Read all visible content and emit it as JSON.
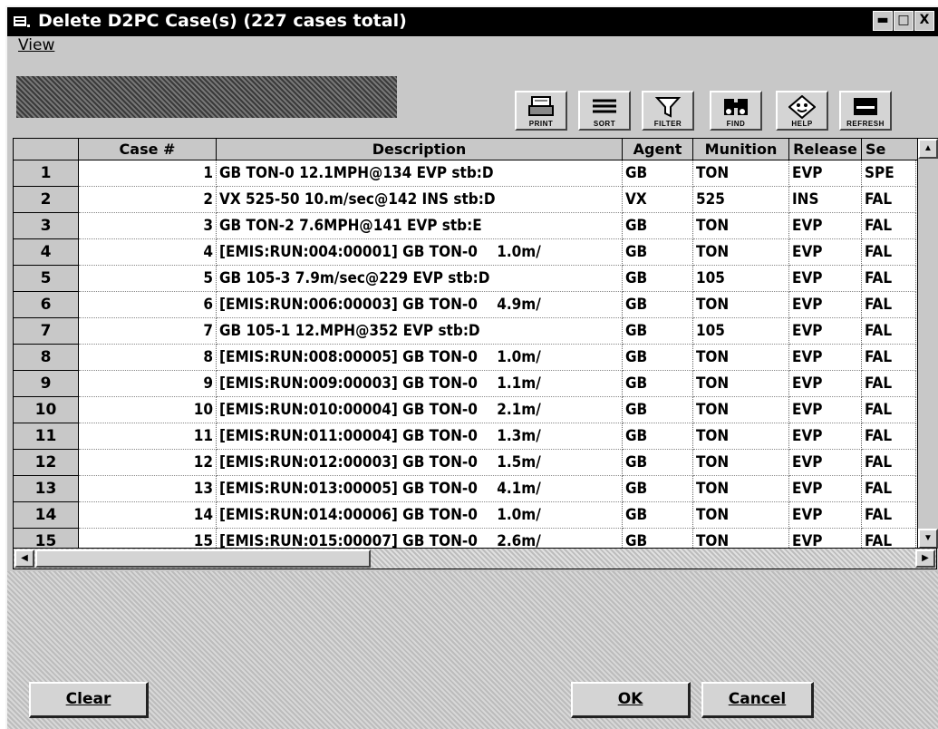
{
  "window": {
    "title": "Delete D2PC Case(s)  (227 cases total)",
    "controls": {
      "minimize": "▬",
      "maximize": "□",
      "close": "X"
    }
  },
  "menu": {
    "view": "View"
  },
  "toolbar": {
    "buttons": [
      {
        "icon": "printer-icon",
        "label": "PRINT"
      },
      {
        "icon": "sort-icon",
        "label": "SORT"
      },
      {
        "icon": "filter-icon",
        "label": "FILTER"
      },
      {
        "icon": "binoculars-icon",
        "label": "FIND"
      },
      {
        "icon": "help-icon",
        "label": "HELP"
      },
      {
        "icon": "refresh-icon",
        "label": "REFRESH"
      }
    ]
  },
  "table": {
    "columns": [
      "Case #",
      "Description",
      "Agent",
      "Munition",
      "Release",
      "Se"
    ],
    "rows": [
      {
        "n": "1",
        "case": "1",
        "desc": "GB TON-0 12.1MPH@134 EVP stb:D",
        "agent": "GB",
        "munition": "TON",
        "release": "EVP",
        "se": "SPE"
      },
      {
        "n": "2",
        "case": "2",
        "desc": "VX 525-50 10.m/sec@142 INS stb:D",
        "agent": "VX",
        "munition": "525",
        "release": "INS",
        "se": "FAL"
      },
      {
        "n": "3",
        "case": "3",
        "desc": "GB TON-2 7.6MPH@141 EVP stb:E",
        "agent": "GB",
        "munition": "TON",
        "release": "EVP",
        "se": "FAL"
      },
      {
        "n": "4",
        "case": "4",
        "desc": "[EMIS:RUN:004:00001] GB TON-0    1.0m/",
        "agent": "GB",
        "munition": "TON",
        "release": "EVP",
        "se": "FAL"
      },
      {
        "n": "5",
        "case": "5",
        "desc": "GB 105-3 7.9m/sec@229 EVP stb:D",
        "agent": "GB",
        "munition": "105",
        "release": "EVP",
        "se": "FAL"
      },
      {
        "n": "6",
        "case": "6",
        "desc": "[EMIS:RUN:006:00003] GB TON-0    4.9m/",
        "agent": "GB",
        "munition": "TON",
        "release": "EVP",
        "se": "FAL"
      },
      {
        "n": "7",
        "case": "7",
        "desc": "GB 105-1 12.MPH@352 EVP stb:D",
        "agent": "GB",
        "munition": "105",
        "release": "EVP",
        "se": "FAL"
      },
      {
        "n": "8",
        "case": "8",
        "desc": "[EMIS:RUN:008:00005] GB TON-0    1.0m/",
        "agent": "GB",
        "munition": "TON",
        "release": "EVP",
        "se": "FAL"
      },
      {
        "n": "9",
        "case": "9",
        "desc": "[EMIS:RUN:009:00003] GB TON-0    1.1m/",
        "agent": "GB",
        "munition": "TON",
        "release": "EVP",
        "se": "FAL"
      },
      {
        "n": "10",
        "case": "10",
        "desc": "[EMIS:RUN:010:00004] GB TON-0    2.1m/",
        "agent": "GB",
        "munition": "TON",
        "release": "EVP",
        "se": "FAL"
      },
      {
        "n": "11",
        "case": "11",
        "desc": "[EMIS:RUN:011:00004] GB TON-0    1.3m/",
        "agent": "GB",
        "munition": "TON",
        "release": "EVP",
        "se": "FAL"
      },
      {
        "n": "12",
        "case": "12",
        "desc": "[EMIS:RUN:012:00003] GB TON-0    1.5m/",
        "agent": "GB",
        "munition": "TON",
        "release": "EVP",
        "se": "FAL"
      },
      {
        "n": "13",
        "case": "13",
        "desc": "[EMIS:RUN:013:00005] GB TON-0    4.1m/",
        "agent": "GB",
        "munition": "TON",
        "release": "EVP",
        "se": "FAL"
      },
      {
        "n": "14",
        "case": "14",
        "desc": "[EMIS:RUN:014:00006] GB TON-0    1.0m/",
        "agent": "GB",
        "munition": "TON",
        "release": "EVP",
        "se": "FAL"
      },
      {
        "n": "15",
        "case": "15",
        "desc": "[EMIS:RUN:015:00007] GB TON-0    2.6m/",
        "agent": "GB",
        "munition": "TON",
        "release": "EVP",
        "se": "FAL"
      }
    ]
  },
  "buttons": {
    "clear": "Clear",
    "ok": "OK",
    "cancel": "Cancel"
  }
}
